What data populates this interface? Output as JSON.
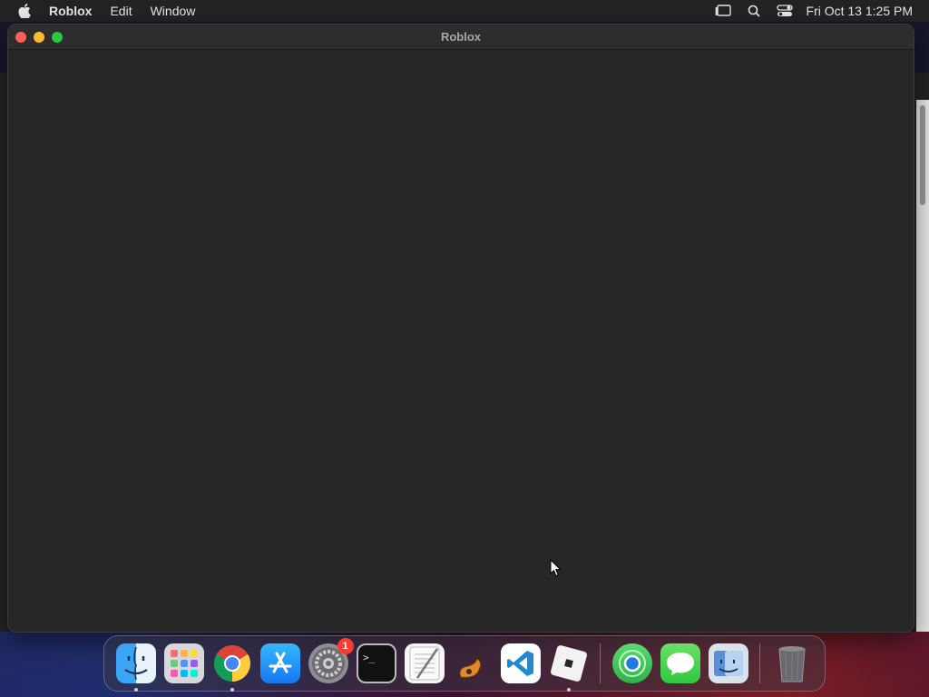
{
  "menubar": {
    "app_name": "Roblox",
    "items": [
      "Edit",
      "Window"
    ],
    "clock": "Fri Oct 13  1:25 PM"
  },
  "window": {
    "title": "Roblox"
  },
  "dock": {
    "apps": [
      {
        "name": "Finder",
        "running": true
      },
      {
        "name": "Launchpad",
        "running": false
      },
      {
        "name": "Google Chrome",
        "running": true
      },
      {
        "name": "App Store",
        "running": false
      },
      {
        "name": "System Settings",
        "running": false,
        "badge": "1"
      },
      {
        "name": "Terminal",
        "running": false
      },
      {
        "name": "TextEdit",
        "running": false
      },
      {
        "name": "GarageBand",
        "running": false
      },
      {
        "name": "Visual Studio Code",
        "running": false
      },
      {
        "name": "Roblox",
        "running": true
      },
      {
        "name": "Find My",
        "running": false
      },
      {
        "name": "Messages",
        "running": false
      },
      {
        "name": "Migration Assistant",
        "running": false
      },
      {
        "name": "Trash",
        "running": false
      }
    ]
  },
  "colors": {
    "menubar_bg": "#232325",
    "window_bg": "#262626",
    "close": "#ff5f57",
    "minimize": "#febc2e",
    "maximize": "#28c840",
    "badge": "#ff3b30"
  }
}
